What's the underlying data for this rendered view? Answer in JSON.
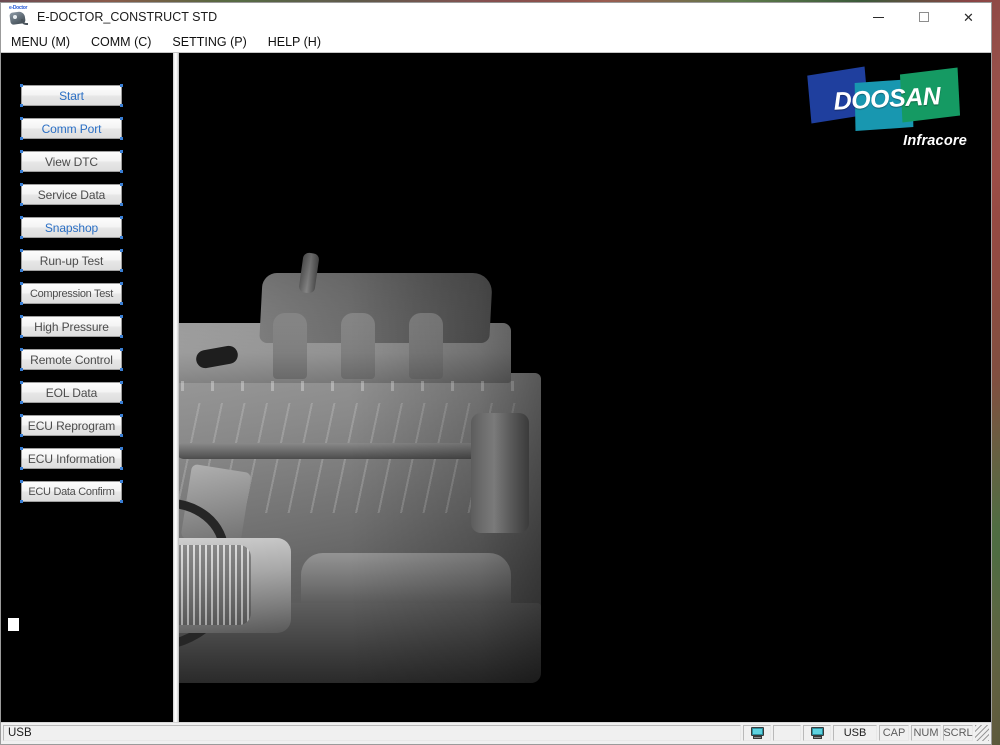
{
  "window": {
    "title": "E-DOCTOR_CONSTRUCT STD",
    "icon": "e-doctor-app-icon",
    "controls": {
      "minimize": "minimize-icon",
      "maximize": "maximize-icon",
      "close": "close-icon"
    }
  },
  "menu": {
    "items": [
      {
        "label": "MENU (M)"
      },
      {
        "label": "COMM (C)"
      },
      {
        "label": "SETTING (P)"
      },
      {
        "label": "HELP (H)"
      }
    ]
  },
  "command_panel": {
    "buttons": [
      {
        "label": "Start",
        "state": "enabled",
        "color": "#2b6fc4"
      },
      {
        "label": "Comm Port",
        "state": "enabled",
        "color": "#2b6fc4"
      },
      {
        "label": "View DTC",
        "state": "disabled",
        "color": "#4c4c4c"
      },
      {
        "label": "Service Data",
        "state": "disabled",
        "color": "#4c4c4c"
      },
      {
        "label": "Snapshop",
        "state": "enabled",
        "color": "#2b6fc4"
      },
      {
        "label": "Run-up Test",
        "state": "disabled",
        "color": "#4c4c4c"
      },
      {
        "label": "Compression Test",
        "state": "disabled",
        "color": "#4c4c4c"
      },
      {
        "label": "High Pressure",
        "state": "disabled",
        "color": "#4c4c4c"
      },
      {
        "label": "Remote Control",
        "state": "disabled",
        "color": "#4c4c4c"
      },
      {
        "label": "EOL Data",
        "state": "disabled",
        "color": "#4c4c4c"
      },
      {
        "label": "ECU Reprogram",
        "state": "disabled",
        "color": "#4c4c4c"
      },
      {
        "label": "ECU Information",
        "state": "disabled",
        "color": "#4c4c4c"
      },
      {
        "label": "ECU Data Confirm",
        "state": "disabled",
        "color": "#4c4c4c"
      }
    ]
  },
  "main_display": {
    "background_image": "diesel-engine-photo",
    "logo": {
      "wordmark": "DOOSAN",
      "subbrand": "Infracore",
      "tile_colors": [
        "#1f3f9e",
        "#1897b0",
        "#159a63"
      ]
    }
  },
  "status_bar": {
    "message": "USB",
    "connection_mode": "USB",
    "icons": [
      "computer-icon",
      "computer-icon"
    ],
    "flags": [
      {
        "label": "CAP"
      },
      {
        "label": "NUM"
      },
      {
        "label": "SCRL"
      }
    ]
  }
}
